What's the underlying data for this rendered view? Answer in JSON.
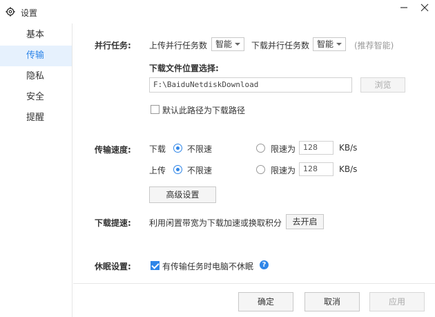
{
  "window": {
    "title": "设置",
    "icon": "gear-icon",
    "minimize_icon": "minimize-icon",
    "close_icon": "close-icon"
  },
  "sidebar": {
    "items": [
      {
        "label": "基本",
        "active": false
      },
      {
        "label": "传输",
        "active": true
      },
      {
        "label": "隐私",
        "active": false
      },
      {
        "label": "安全",
        "active": false
      },
      {
        "label": "提醒",
        "active": false
      }
    ]
  },
  "parallel": {
    "section_label": "并行任务:",
    "upload_label": "上传并行任务数",
    "upload_value": "智能",
    "download_label": "下载并行任务数",
    "download_value": "智能",
    "hint": "(推荐智能)"
  },
  "download_location": {
    "label": "下载文件位置选择:",
    "path": "F:\\BaiduNetdiskDownload",
    "browse_label": "浏览",
    "default_checkbox_label": "默认此路径为下载路径",
    "default_checked": false
  },
  "speed": {
    "section_label": "传输速度:",
    "download_label": "下载",
    "upload_label": "上传",
    "unlimited_label": "不限速",
    "limit_label": "限速为",
    "download_limit_value": "128",
    "upload_limit_value": "128",
    "unit": "KB/s",
    "download_mode": "unlimited",
    "upload_mode": "unlimited",
    "advanced_label": "高级设置"
  },
  "boost": {
    "section_label": "下载提速:",
    "description": "利用闲置带宽为下载加速或换取积分",
    "button_label": "去开启"
  },
  "sleep": {
    "section_label": "休眠设置:",
    "checkbox_label": "有传输任务时电脑不休眠",
    "checked": true,
    "help_icon": "question-icon"
  },
  "footer": {
    "ok_label": "确定",
    "cancel_label": "取消",
    "apply_label": "应用"
  },
  "colors": {
    "accent": "#2f86e8",
    "active_bg": "#e6f1fd"
  }
}
